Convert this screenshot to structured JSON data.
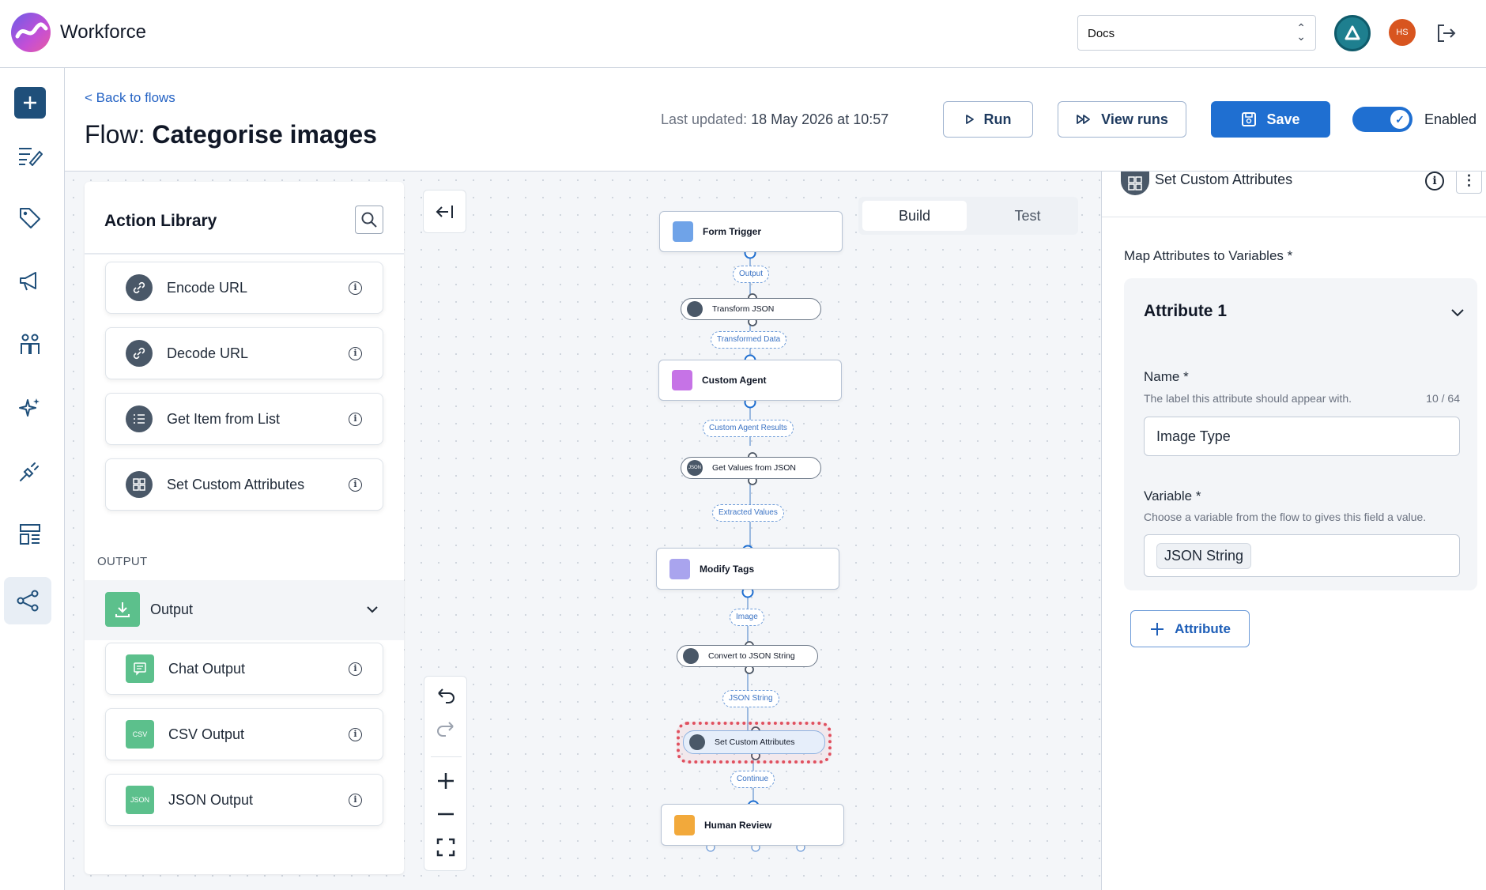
{
  "app": {
    "name": "Workforce"
  },
  "topbar": {
    "workspace_select": "Docs",
    "user_initials": "HS"
  },
  "header": {
    "back_link": "< Back to flows",
    "flow_prefix": "Flow:",
    "flow_name": "Categorise images",
    "last_updated_label": "Last updated:",
    "last_updated_value": "18 May 2026 at 10:57",
    "run_label": "Run",
    "view_runs_label": "View runs",
    "save_label": "Save",
    "enabled_label": "Enabled",
    "enabled": true
  },
  "library": {
    "title": "Action Library",
    "items": [
      {
        "label": "Encode URL",
        "icon": "link-icon"
      },
      {
        "label": "Decode URL",
        "icon": "link-icon"
      },
      {
        "label": "Get Item from List",
        "icon": "list-icon"
      },
      {
        "label": "Set Custom Attributes",
        "icon": "grid-icon"
      }
    ],
    "output_section": "OUTPUT",
    "output_group": "Output",
    "output_items": [
      {
        "label": "Chat Output",
        "icon": "chat-icon"
      },
      {
        "label": "CSV Output",
        "icon": "csv-icon",
        "icon_text": "CSV"
      },
      {
        "label": "JSON Output",
        "icon": "json-icon",
        "icon_text": "JSON"
      }
    ]
  },
  "canvas": {
    "tabs": {
      "build": "Build",
      "test": "Test",
      "active": "Build"
    },
    "nodes": {
      "form_trigger": "Form Trigger",
      "transform_json": "Transform JSON",
      "custom_agent": "Custom Agent",
      "get_values": "Get Values from JSON",
      "get_values_icon_text": "JSON",
      "modify_tags": "Modify Tags",
      "convert_json": "Convert to JSON String",
      "set_custom": "Set Custom Attributes",
      "human_review": "Human Review"
    },
    "edges": {
      "output": "Output",
      "transformed": "Transformed Data",
      "agent_results": "Custom Agent Results",
      "extracted": "Extracted Values",
      "image": "Image",
      "json_string": "JSON String",
      "continue": "Continue"
    },
    "selected_node": "Set Custom Attributes"
  },
  "panel": {
    "title": "Set Custom Attributes",
    "map_label": "Map Attributes to Variables *",
    "attribute_title": "Attribute 1",
    "name_label": "Name *",
    "name_help": "The label this attribute should appear with.",
    "name_count": "10 / 64",
    "name_value": "Image Type",
    "variable_label": "Variable *",
    "variable_help": "Choose a variable from the flow to gives this field a value.",
    "variable_value": "JSON String",
    "add_attribute": "Attribute"
  },
  "colors": {
    "accent": "#1f6fd1",
    "selected_outline": "#e0505f"
  }
}
